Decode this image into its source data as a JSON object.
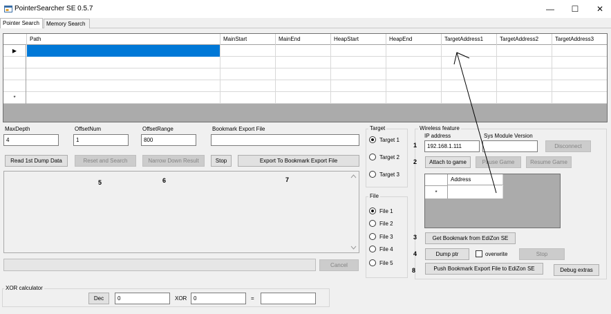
{
  "window": {
    "title": "PointerSearcher SE 0.5.7",
    "controls": {
      "minimize": "—",
      "maximize": "☐",
      "close": "✕"
    }
  },
  "tabs": [
    "Pointer Search",
    "Memory Search"
  ],
  "grid": {
    "columns": [
      "Path",
      "MainStart",
      "MainEnd",
      "HeapStart",
      "HeapEnd",
      "TargetAddress1",
      "TargetAddress2",
      "TargetAddress3"
    ],
    "current_row_marker": "▶",
    "new_row_marker": "*"
  },
  "params": {
    "max_depth": {
      "label": "MaxDepth",
      "value": "4"
    },
    "offset_num": {
      "label": "OffsetNum",
      "value": "1"
    },
    "offset_range": {
      "label": "OffsetRange",
      "value": "800"
    },
    "bookmark_export": {
      "label": "Bookmark Export File",
      "value": ""
    }
  },
  "buttons": {
    "read_dump": "Read 1st Dump Data",
    "reset_search": "Reset and Search",
    "narrow_down": "Narrow Down Result",
    "stop": "Stop",
    "export_bookmark": "Export To Bookmark Export File",
    "cancel": "Cancel"
  },
  "annotations": {
    "n1": "1",
    "n2": "2",
    "n3": "3",
    "n4": "4",
    "n5": "5",
    "n6": "6",
    "n7": "7",
    "n8": "8"
  },
  "target_group": {
    "title": "Target",
    "options": [
      "Target 1",
      "Target 2",
      "Target 3"
    ],
    "selected": "Target 1"
  },
  "file_group": {
    "title": "File",
    "options": [
      "File 1",
      "File 2",
      "File 3",
      "File 4",
      "File 5"
    ],
    "selected": "File 1"
  },
  "wireless": {
    "title": "Wireless feature",
    "ip_label": "IP address",
    "ip_value": "192.168.1.111",
    "sys_module_label": "Sys Module Version",
    "sys_module_value": "",
    "disconnect": "Disconnect",
    "attach": "Attach to game",
    "pause": "Pause Game",
    "resume": "Resume Game",
    "address_column": "Address",
    "new_row_marker": "*",
    "get_bookmark": "Get Bookmark from EdiZon SE",
    "dump_ptr": "Dump ptr",
    "overwrite": "overwrite",
    "stop": "Stop",
    "push_bookmark": "Push Bookmark Export File to EdiZon SE",
    "debug_extras": "Debug extras"
  },
  "xor": {
    "title": "XOR calculator",
    "dec_button": "Dec",
    "left_value": "0",
    "operator": "XOR",
    "right_value": "0",
    "equals": "=",
    "result": ""
  },
  "colors": {
    "selection": "#0078d7",
    "grid_background": "#ababab"
  }
}
